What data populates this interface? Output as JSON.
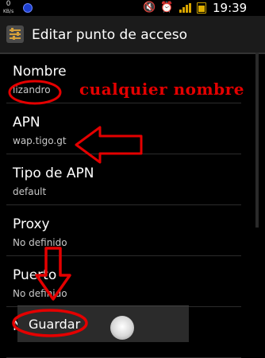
{
  "status_bar": {
    "data_rate": "0",
    "data_rate_unit": "KB/s",
    "time": "19:39"
  },
  "action_bar": {
    "title": "Editar punto de acceso",
    "icon": "settings-sliders-icon"
  },
  "preferences": [
    {
      "title": "Nombre",
      "summary": "lizandro"
    },
    {
      "title": "APN",
      "summary": "wap.tigo.gt"
    },
    {
      "title": "Tipo de APN",
      "summary": "default"
    },
    {
      "title": "Proxy",
      "summary": "No definido"
    },
    {
      "title": "Puerto",
      "summary": "No definido"
    },
    {
      "title": "N",
      "summary": ""
    }
  ],
  "annotations": {
    "text": "cualquier nombre",
    "color": "#e40000"
  },
  "menu": {
    "save_label": "Guardar"
  }
}
